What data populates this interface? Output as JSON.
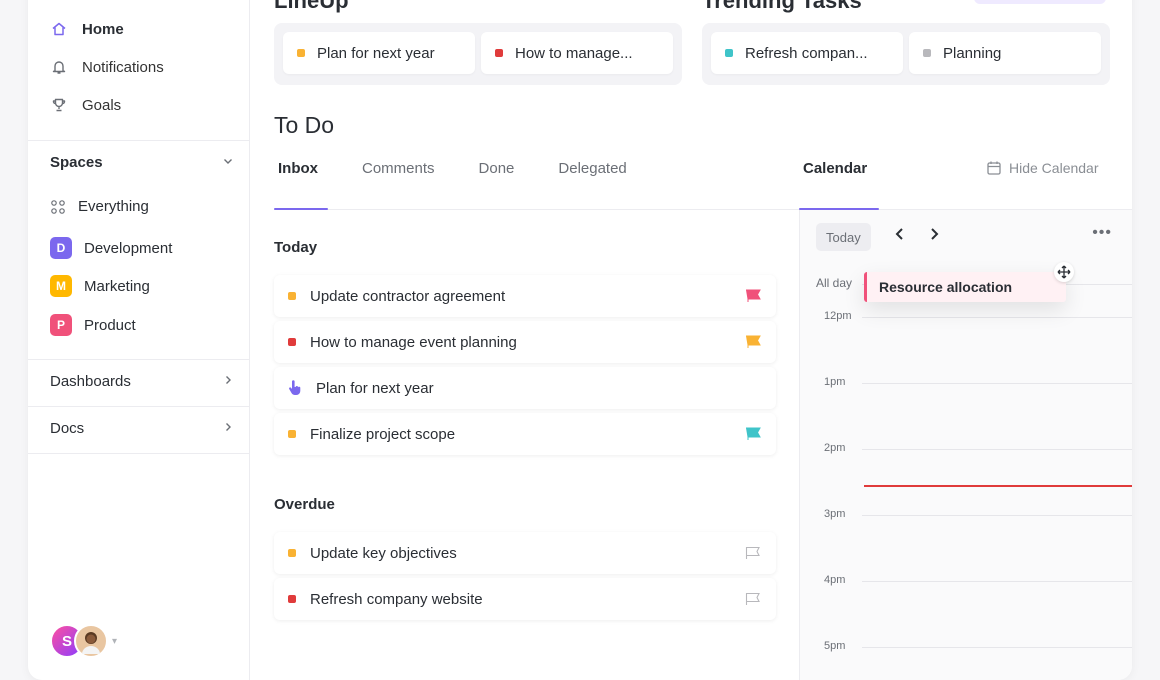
{
  "sidebar": {
    "nav": [
      {
        "label": "Home",
        "icon": "home-icon"
      },
      {
        "label": "Notifications",
        "icon": "bell-icon"
      },
      {
        "label": "Goals",
        "icon": "trophy-icon"
      }
    ],
    "spaces_title": "Spaces",
    "spaces": [
      {
        "label": "Everything",
        "badge": "",
        "color": ""
      },
      {
        "label": "Development",
        "badge": "D",
        "color": "#7b68ee"
      },
      {
        "label": "Marketing",
        "badge": "M",
        "color": "#ffb800"
      },
      {
        "label": "Product",
        "badge": "P",
        "color": "#f0517a"
      }
    ],
    "dashboards": "Dashboards",
    "docs": "Docs",
    "avatar_initial": "S"
  },
  "top": {
    "lineup_title": "LineUp",
    "lineup": [
      {
        "label": "Plan for next year",
        "color": "#f9b233"
      },
      {
        "label": "How to manage...",
        "color": "#e03b3b"
      }
    ],
    "trending_title": "Trending Tasks",
    "trending": [
      {
        "label": "Refresh compan...",
        "color": "#3fc4c9"
      },
      {
        "label": "Planning",
        "color": "#b8b8bc"
      }
    ]
  },
  "todo": {
    "title": "To Do",
    "tabs": [
      "Inbox",
      "Comments",
      "Done",
      "Delegated"
    ],
    "today_label": "Today",
    "today": [
      {
        "label": "Update contractor agreement",
        "color": "#f9b233",
        "flag": "#f0517a"
      },
      {
        "label": "How to manage event planning",
        "color": "#e03b3b",
        "flag": "#f9b233"
      },
      {
        "label": "Plan for next year",
        "color": "#7b68ee",
        "flag": ""
      },
      {
        "label": "Finalize project scope",
        "color": "#f9b233",
        "flag": "#3fc4c9"
      }
    ],
    "overdue_label": "Overdue",
    "overdue": [
      {
        "label": "Update key objectives",
        "color": "#f9b233",
        "flag": "outline"
      },
      {
        "label": "Refresh company website",
        "color": "#e03b3b",
        "flag": "outline"
      }
    ]
  },
  "calendar": {
    "tab": "Calendar",
    "hide": "Hide Calendar",
    "today_btn": "Today",
    "all_day": "All day",
    "event": "Resource allocation",
    "hours": [
      "12pm",
      "1pm",
      "2pm",
      "3pm",
      "4pm",
      "5pm"
    ]
  }
}
